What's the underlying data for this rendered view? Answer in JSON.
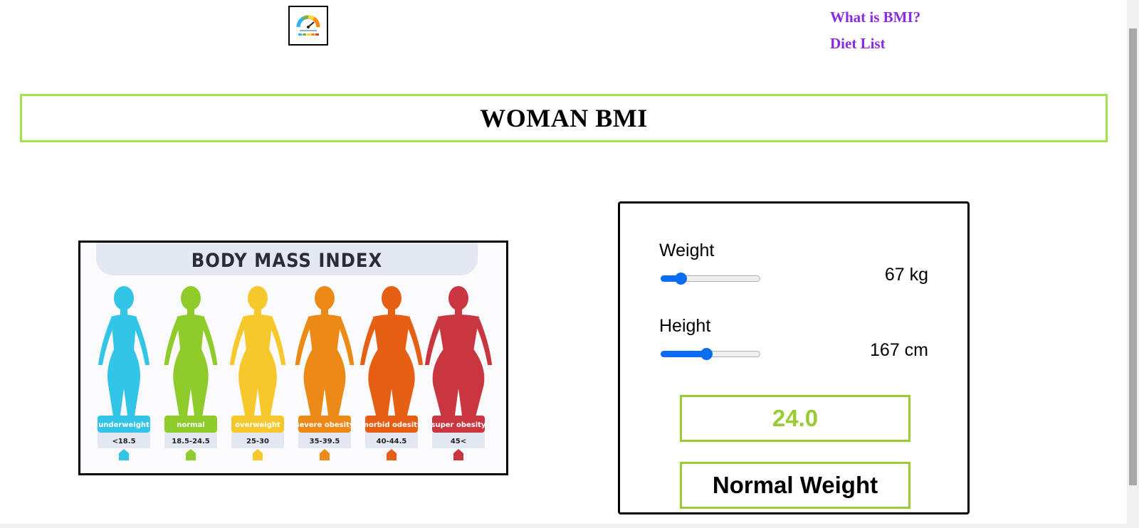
{
  "nav": {
    "items": [
      "What is BMI?",
      "Diet List"
    ]
  },
  "title": "WOMAN BMI",
  "infographic": {
    "heading": "BODY MASS INDEX",
    "categories": [
      {
        "label": "underweight",
        "range": "<18.5",
        "color": "#33c5e8"
      },
      {
        "label": "normal",
        "range": "18.5-24.5",
        "color": "#8fcb2b"
      },
      {
        "label": "overweight",
        "range": "25-30",
        "color": "#f6c82b"
      },
      {
        "label": "severe obesity",
        "range": "35-39.5",
        "color": "#eb8a17"
      },
      {
        "label": "morbid odesity",
        "range": "40-44.5",
        "color": "#e65f15"
      },
      {
        "label": "super obesity",
        "range": "45<",
        "color": "#c9363f"
      }
    ]
  },
  "calculator": {
    "weight": {
      "label": "Weight",
      "value_text": "67 kg",
      "slider_fraction": 0.2
    },
    "height": {
      "label": "Height",
      "value_text": "167 cm",
      "slider_fraction": 0.46
    },
    "bmi": "24.0",
    "category": "Normal Weight"
  },
  "colors": {
    "nav_link": "#8a2be2",
    "accent_green": "#99cc33",
    "title_border": "#a6e14a",
    "slider": "#0a6cf2"
  },
  "icons": {
    "logo": "bmi-gauge-logo-icon"
  }
}
